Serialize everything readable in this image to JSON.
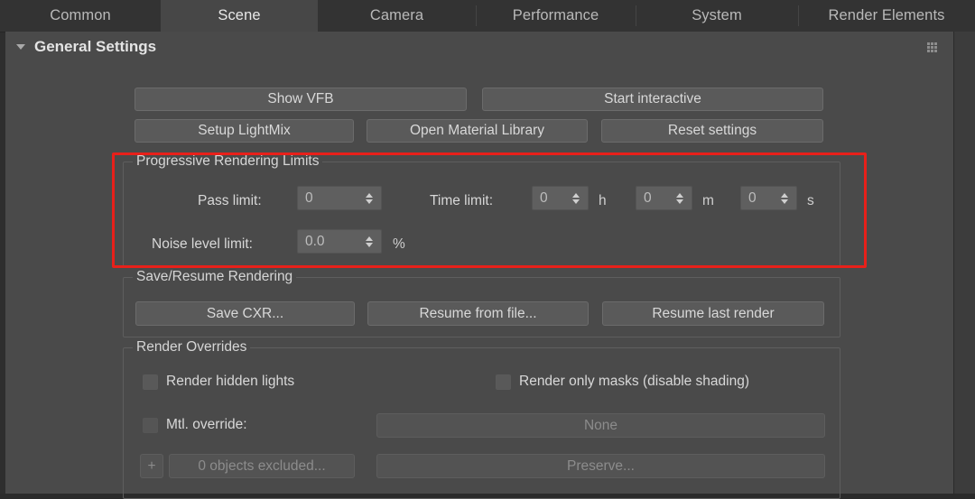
{
  "tabs": [
    {
      "label": "Common",
      "active": false
    },
    {
      "label": "Scene",
      "active": true
    },
    {
      "label": "Camera",
      "active": false
    },
    {
      "label": "Performance",
      "active": false
    },
    {
      "label": "System",
      "active": false
    },
    {
      "label": "Render Elements",
      "active": false
    }
  ],
  "rollout": {
    "title": "General Settings",
    "collapse_icon": "triangle-down-icon",
    "grip_icon": "grip-dots-icon"
  },
  "actions": {
    "show_vfb": "Show VFB",
    "start_interactive": "Start interactive",
    "setup_lightmix": "Setup LightMix",
    "open_material_library": "Open Material Library",
    "reset_settings": "Reset settings"
  },
  "progressive_limits": {
    "title": "Progressive Rendering Limits",
    "highlight_color": "#e8201a",
    "pass_limit": {
      "label": "Pass limit:",
      "value": "0"
    },
    "time_limit": {
      "label": "Time limit:",
      "hours": {
        "value": "0",
        "unit": "h"
      },
      "minutes": {
        "value": "0",
        "unit": "m"
      },
      "seconds": {
        "value": "0",
        "unit": "s"
      }
    },
    "noise_level_limit": {
      "label": "Noise level limit:",
      "value": "0.0",
      "unit": "%"
    }
  },
  "save_resume": {
    "title": "Save/Resume Rendering",
    "save_cxr": "Save CXR...",
    "resume_from_file": "Resume from file...",
    "resume_last_render": "Resume last render"
  },
  "render_overrides": {
    "title": "Render Overrides",
    "render_hidden_lights": {
      "label": "Render hidden lights",
      "checked": false
    },
    "render_only_masks": {
      "label": "Render only masks (disable shading)",
      "checked": false
    },
    "mtl_override": {
      "label": "Mtl. override:",
      "checked": false,
      "value": "None"
    },
    "exclude": {
      "plus_icon": "plus-icon",
      "label": "0 objects excluded...",
      "preserve": "Preserve..."
    }
  }
}
